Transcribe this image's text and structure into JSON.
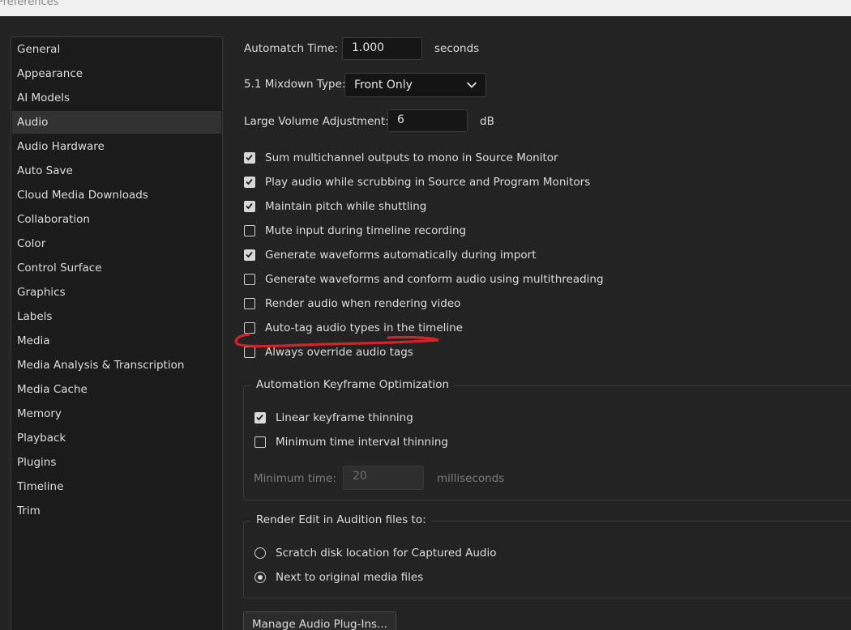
{
  "window": {
    "title": "Preferences"
  },
  "sidebar": {
    "selected": "Audio",
    "items": [
      {
        "label": "General"
      },
      {
        "label": "Appearance"
      },
      {
        "label": "AI Models"
      },
      {
        "label": "Audio"
      },
      {
        "label": "Audio Hardware"
      },
      {
        "label": "Auto Save"
      },
      {
        "label": "Cloud Media Downloads"
      },
      {
        "label": "Collaboration"
      },
      {
        "label": "Color"
      },
      {
        "label": "Control Surface"
      },
      {
        "label": "Graphics"
      },
      {
        "label": "Labels"
      },
      {
        "label": "Media"
      },
      {
        "label": "Media Analysis & Transcription"
      },
      {
        "label": "Media Cache"
      },
      {
        "label": "Memory"
      },
      {
        "label": "Playback"
      },
      {
        "label": "Plugins"
      },
      {
        "label": "Timeline"
      },
      {
        "label": "Trim"
      }
    ]
  },
  "audio": {
    "automatch": {
      "label": "Automatch Time:",
      "value": "1.000",
      "unit": "seconds"
    },
    "mixdown": {
      "label": "5.1 Mixdown Type:",
      "value": "Front Only"
    },
    "large_volume": {
      "label": "Large Volume Adjustment:",
      "value": "6",
      "unit": "dB"
    },
    "checkboxes": [
      {
        "label": "Sum multichannel outputs to mono in Source Monitor",
        "checked": true
      },
      {
        "label": "Play audio while scrubbing in Source and Program Monitors",
        "checked": true
      },
      {
        "label": "Maintain pitch while shuttling",
        "checked": true
      },
      {
        "label": "Mute input during timeline recording",
        "checked": false
      },
      {
        "label": "Generate waveforms automatically during import",
        "checked": true
      },
      {
        "label": "Generate waveforms and conform audio using multithreading",
        "checked": false
      },
      {
        "label": "Render audio when rendering video",
        "checked": false
      },
      {
        "label": "Auto-tag audio types in the timeline",
        "checked": false
      },
      {
        "label": "Always override audio tags",
        "checked": false
      }
    ],
    "keyframe_group": {
      "title": "Automation Keyframe Optimization",
      "options": [
        {
          "label": "Linear keyframe thinning",
          "checked": true
        },
        {
          "label": "Minimum time interval thinning",
          "checked": false
        }
      ],
      "min_time": {
        "label": "Minimum time:",
        "value": "20",
        "unit": "milliseconds"
      }
    },
    "render_group": {
      "title": "Render Edit in Audition files to:",
      "options": [
        {
          "label": "Scratch disk location for Captured Audio",
          "selected": false
        },
        {
          "label": "Next to original media files",
          "selected": true
        }
      ]
    },
    "manage_button": "Manage Audio Plug-Ins..."
  },
  "colors": {
    "background": "#232323",
    "sidebar": "#1b1b1b",
    "annotation": "#d4222a"
  }
}
